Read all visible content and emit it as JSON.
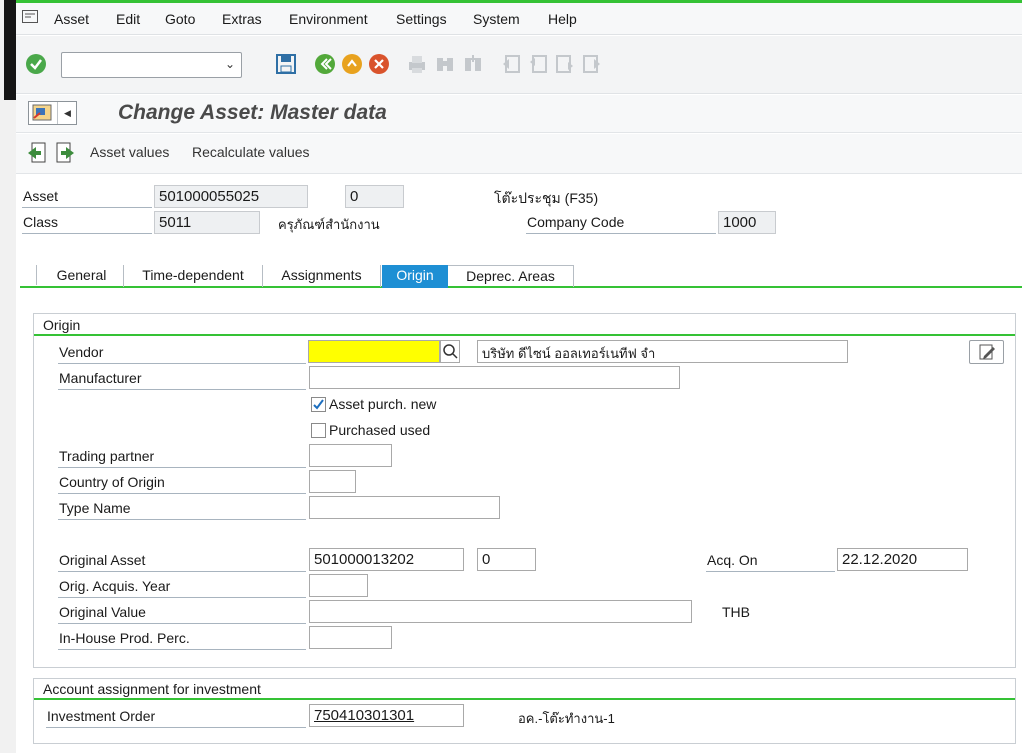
{
  "menu": {
    "items": [
      "Asset",
      "Edit",
      "Goto",
      "Extras",
      "Environment",
      "Settings",
      "System",
      "Help"
    ]
  },
  "title": "Change Asset:  Master data",
  "app_toolbar": {
    "asset_values": "Asset values",
    "recalculate_values": "Recalculate values"
  },
  "header": {
    "asset_label": "Asset",
    "asset_number": "501000055025",
    "asset_sub": "0",
    "asset_description": "โต๊ะประชุม (F35)",
    "class_label": "Class",
    "class_value": "5011",
    "class_description": "ครุภัณฑ์สำนักงาน",
    "company_code_label": "Company Code",
    "company_code_value": "1000"
  },
  "tabs": [
    "General",
    "Time-dependent",
    "Assignments",
    "Origin",
    "Deprec. Areas"
  ],
  "active_tab": "Origin",
  "origin": {
    "group_title": "Origin",
    "vendor_label": "Vendor",
    "vendor_value": "",
    "vendor_name": "บริษัท ดีไซน์ ออลเทอร์เนทีฟ จำ",
    "manufacturer_label": "Manufacturer",
    "manufacturer_value": "",
    "asset_purch_new_label": "Asset purch. new",
    "asset_purch_new_checked": true,
    "purchased_used_label": "Purchased used",
    "purchased_used_checked": false,
    "trading_partner_label": "Trading partner",
    "trading_partner_value": "",
    "country_label": "Country of Origin",
    "country_value": "",
    "type_name_label": "Type Name",
    "type_name_value": "",
    "original_asset_label": "Original Asset",
    "original_asset_value": "501000013202",
    "original_asset_sub": "0",
    "acq_on_label": "Acq. On",
    "acq_on_value": "22.12.2020",
    "orig_acq_year_label": "Orig. Acquis. Year",
    "orig_acq_year_value": "",
    "original_value_label": "Original Value",
    "original_value_value": "",
    "currency": "THB",
    "inhouse_label": "In-House Prod. Perc.",
    "inhouse_value": ""
  },
  "investment": {
    "group_title": "Account assignment for investment",
    "order_label": "Investment Order",
    "order_value": "750410301301",
    "order_description": "อค.-โต๊ะทำงาน-1"
  },
  "colors": {
    "accent_green": "#35c235",
    "tab_active": "#1e8fd4",
    "vendor_highlight": "#ffff00"
  }
}
